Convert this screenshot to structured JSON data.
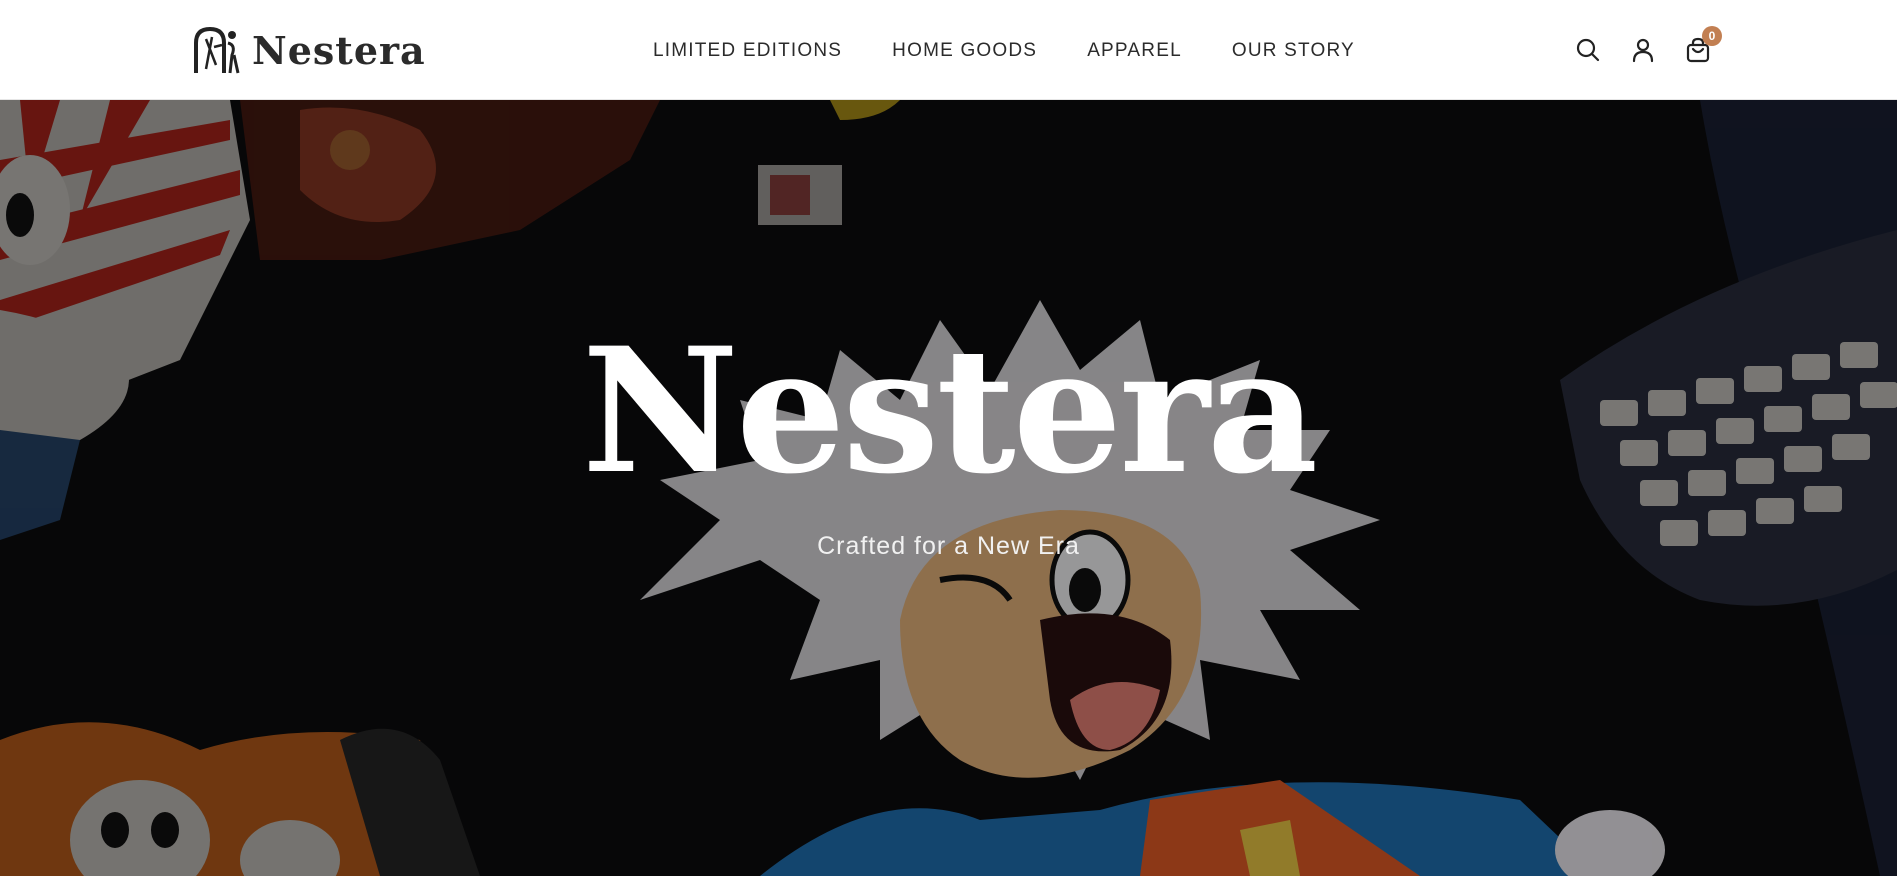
{
  "brand": {
    "name": "Nestera"
  },
  "nav": {
    "items": [
      {
        "label": "LIMITED EDITIONS"
      },
      {
        "label": "HOME GOODS"
      },
      {
        "label": "APPAREL"
      },
      {
        "label": "OUR STORY"
      }
    ]
  },
  "header_icons": {
    "search": "search-icon",
    "account": "user-icon",
    "cart": "shopping-bag-icon",
    "cart_count": "0"
  },
  "hero": {
    "title": "Nestera",
    "subtitle": "Crafted for a New Era"
  },
  "colors": {
    "accent": "#c27f52",
    "header_bg": "#ffffff",
    "text_dark": "#2b2b2b",
    "hero_text": "#ffffff"
  }
}
